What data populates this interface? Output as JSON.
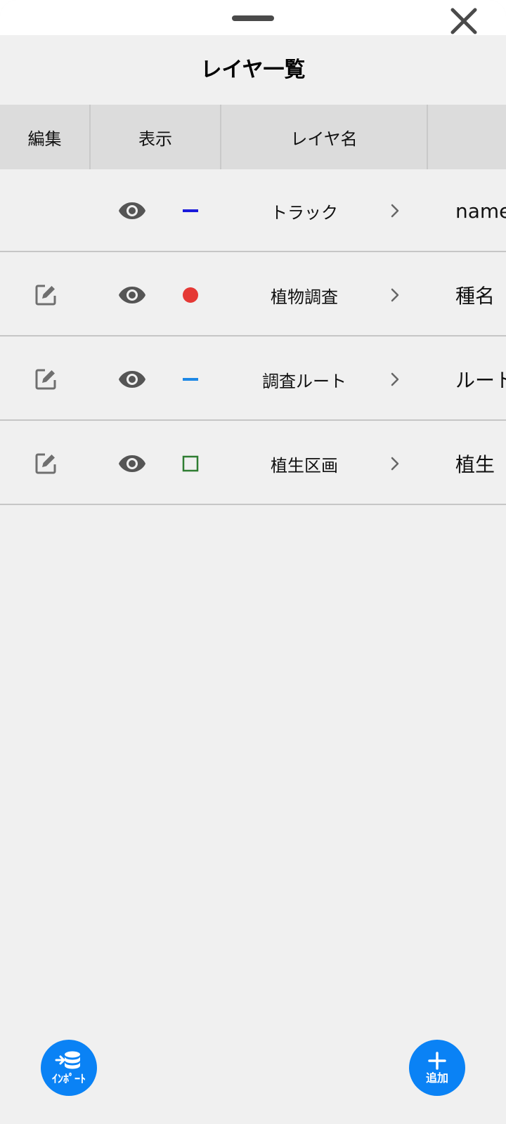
{
  "sheet": {
    "title": "レイヤ一覧"
  },
  "table": {
    "headers": [
      "編集",
      "表示",
      "レイヤ名",
      ""
    ],
    "rows": [
      {
        "editable": false,
        "visible": true,
        "symbol": "line",
        "symbol_color": "#1a1adb",
        "name": "トラック",
        "attribute": "name"
      },
      {
        "editable": true,
        "visible": true,
        "symbol": "point",
        "symbol_color": "#e53935",
        "name": "植物調査",
        "attribute": "種名"
      },
      {
        "editable": true,
        "visible": true,
        "symbol": "line",
        "symbol_color": "#1e88e5",
        "name": "調査ルート",
        "attribute": "ルート"
      },
      {
        "editable": true,
        "visible": true,
        "symbol": "polygon",
        "symbol_color": "#2e7d32",
        "name": "植生区画",
        "attribute": "植生"
      }
    ]
  },
  "actions": {
    "import_label": "ｲﾝﾎﾟｰﾄ",
    "add_label": "追加"
  },
  "colors": {
    "accent": "#0a82f5",
    "background": "#f0f0f0",
    "header": "#dcdcdc"
  },
  "icons": {
    "close": "close-icon",
    "edit": "edit-icon",
    "visible": "eye-icon",
    "chevron": "chevron-right-icon",
    "import": "database-import-icon",
    "add": "plus-icon"
  }
}
